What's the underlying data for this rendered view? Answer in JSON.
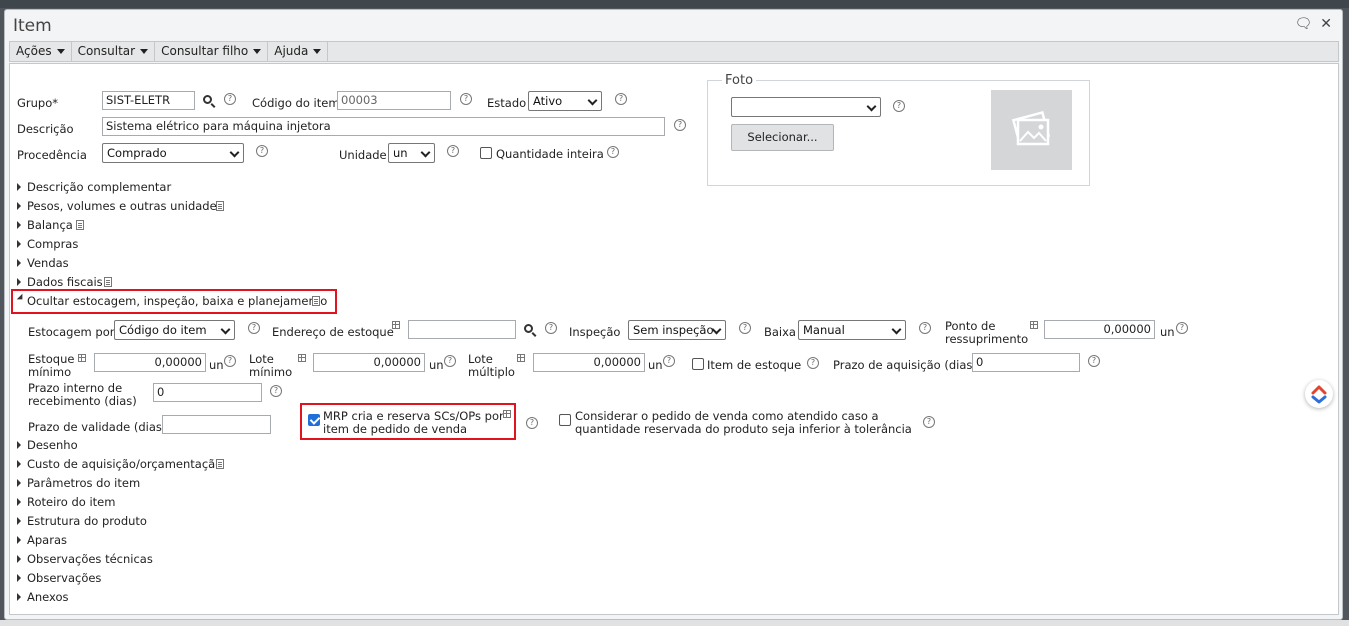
{
  "window": {
    "title": "Item"
  },
  "menubar": [
    {
      "label": "Ações"
    },
    {
      "label": "Consultar"
    },
    {
      "label": "Consultar filho"
    },
    {
      "label": "Ajuda"
    }
  ],
  "form": {
    "grupo_label": "Grupo*",
    "grupo_value": "SIST-ELETR",
    "codigo_label": "Código do item",
    "codigo_value": "00003",
    "estado_label": "Estado",
    "estado_value": "Ativo",
    "descricao_label": "Descrição",
    "descricao_value": "Sistema elétrico para máquina injetora",
    "procedencia_label": "Procedência",
    "procedencia_value": "Comprado",
    "unidade_label": "Unidade",
    "unidade_value": "un",
    "quantidade_inteira_label": "Quantidade inteira"
  },
  "foto": {
    "legend": "Foto",
    "select_value": "",
    "button_label": "Selecionar..."
  },
  "sections_top": [
    {
      "label": "Descrição complementar"
    },
    {
      "label": "Pesos, volumes e outras unidades"
    },
    {
      "label": "Balança"
    },
    {
      "label": "Compras"
    },
    {
      "label": "Vendas"
    },
    {
      "label": "Dados fiscais"
    }
  ],
  "expanded_section": {
    "label": "Ocultar estocagem, inspeção, baixa e planejamento"
  },
  "estocagem": {
    "estocagem_por_label": "Estocagem por",
    "estocagem_por_value": "Código do item",
    "endereco_label": "Endereço de estoque",
    "endereco_value": "",
    "inspecao_label": "Inspeção",
    "inspecao_value": "Sem inspeção",
    "baixa_label": "Baixa",
    "baixa_value": "Manual",
    "ponto_label_1": "Ponto de",
    "ponto_label_2": "ressuprimento",
    "ponto_value": "0,00000",
    "ponto_unit": "un",
    "estoque_min_label_1": "Estoque",
    "estoque_min_label_2": "mínimo",
    "estoque_min_value": "0,00000",
    "estoque_min_unit": "un",
    "lote_min_label_1": "Lote",
    "lote_min_label_2": "mínimo",
    "lote_min_value": "0,00000",
    "lote_min_unit": "un",
    "lote_mult_label_1": "Lote",
    "lote_mult_label_2": "múltiplo",
    "lote_mult_value": "0,00000",
    "lote_mult_unit": "un",
    "item_estoque_label": "Item de estoque",
    "prazo_aquisicao_label": "Prazo de aquisição (dias)",
    "prazo_aquisicao_value": "0",
    "prazo_interno_label_1": "Prazo interno de",
    "prazo_interno_label_2": "recebimento (dias)",
    "prazo_interno_value": "0",
    "prazo_validade_label": "Prazo de validade (dias)",
    "prazo_validade_value": "",
    "mrp_label_1": "MRP cria e reserva SCs/OPs por",
    "mrp_label_2": "item de pedido de venda",
    "considerar_label_1": "Considerar o pedido de venda como atendido caso a",
    "considerar_label_2": "quantidade reservada do produto seja inferior à tolerância"
  },
  "sections_bottom": [
    {
      "label": "Desenho"
    },
    {
      "label": "Custo de aquisição/orçamentação"
    },
    {
      "label": "Parâmetros do item"
    },
    {
      "label": "Roteiro do item"
    },
    {
      "label": "Estrutura do produto"
    },
    {
      "label": "Aparas"
    },
    {
      "label": "Observações técnicas"
    },
    {
      "label": "Observações"
    },
    {
      "label": "Anexos"
    }
  ],
  "colors": {
    "highlight": "#e0141e",
    "checkbox": "#1e6fd9"
  }
}
